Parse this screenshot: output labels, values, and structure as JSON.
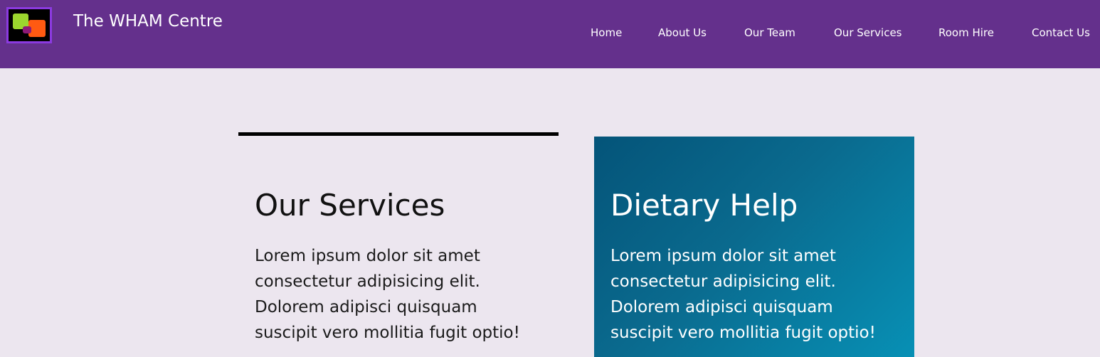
{
  "header": {
    "site_title": "The WHAM Centre",
    "logo": "wham-logo-icon",
    "background_color": "#64308c"
  },
  "nav": {
    "items": [
      {
        "label": "Home"
      },
      {
        "label": "About Us"
      },
      {
        "label": "Our Team"
      },
      {
        "label": "Our Services"
      },
      {
        "label": "Room Hire"
      },
      {
        "label": "Contact Us"
      }
    ]
  },
  "services": {
    "heading": "Our Services",
    "text": "Lorem ipsum dolor sit amet\nconsectetur adipisicing elit.\nDolorem adipisci quisquam\nsuscipit vero mollitia fugit optio!"
  },
  "dietary_card": {
    "heading": "Dietary Help",
    "text": "Lorem ipsum dolor sit amet\nconsectetur adipisicing elit.\nDolorem adipisci quisquam\nsuscipit vero mollitia fugit optio!",
    "accent_color": "#0a6a8e"
  },
  "page": {
    "background_color": "#ece6ef"
  }
}
